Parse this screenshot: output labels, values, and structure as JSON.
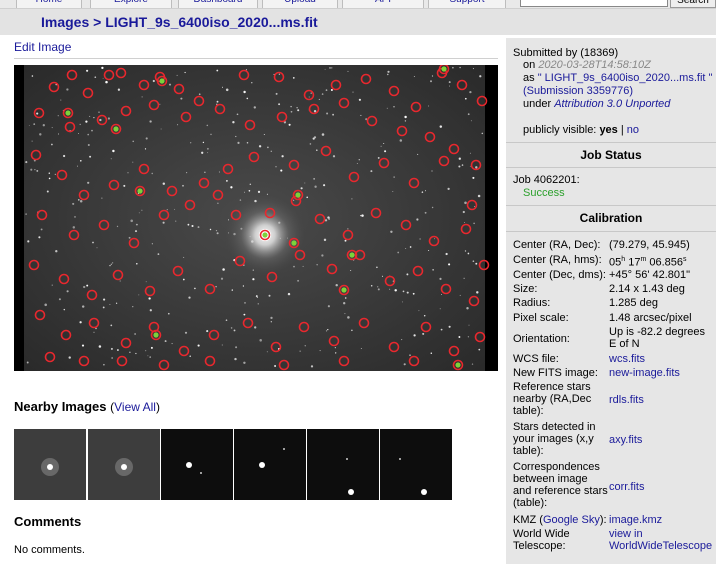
{
  "nav": {
    "items": [
      "Home",
      "Explore",
      "Dashboard",
      "Upload",
      "API",
      "Support"
    ],
    "search_button": "Search"
  },
  "breadcrumb": {
    "section": "Images",
    "separator": ">",
    "current": "LIGHT_9s_6400iso_2020...ms.fit"
  },
  "edit_image": "Edit Image",
  "nearby": {
    "heading": "Nearby Images",
    "view_all": "View All",
    "thumb_count": 6
  },
  "comments": {
    "heading": "Comments",
    "empty_text": "No comments."
  },
  "submission": {
    "submitted_by_label": "Submitted by",
    "submitter": "(18369)",
    "on_label": "on",
    "date": "2020-03-28T14:58:10Z",
    "as_label": "as",
    "file": "\" LIGHT_9s_6400iso_2020...ms.fit \"",
    "submission_link": "(Submission 3359776)",
    "under_label": "under",
    "license": "Attribution 3.0 Unported",
    "public_label": "publicly visible:",
    "public_yes": "yes",
    "public_sep": "|",
    "public_no": "no"
  },
  "job": {
    "heading": "Job Status",
    "job_label": "Job 4062201:",
    "status": "Success"
  },
  "calibration": {
    "heading": "Calibration",
    "rows": [
      {
        "key": "Center (RA, Dec):",
        "value": "(79.279, 45.945)"
      },
      {
        "key": "Center (RA, hms):",
        "value": "05h 17m 06.856s"
      },
      {
        "key": "Center (Dec, dms):",
        "value": "+45° 56' 42.801\""
      },
      {
        "key": "Size:",
        "value": "2.14 x 1.43 deg"
      },
      {
        "key": "Radius:",
        "value": "1.285 deg"
      },
      {
        "key": "Pixel scale:",
        "value": "1.48 arcsec/pixel"
      },
      {
        "key": "Orientation:",
        "value": "Up is -82.2 degrees E of N"
      },
      {
        "key": "WCS file:",
        "value": "wcs.fits"
      },
      {
        "key": "New FITS image:",
        "value": "new-image.fits"
      },
      {
        "key": "Reference stars nearby (RA,Dec table):",
        "value": "rdls.fits"
      },
      {
        "key": "Stars detected in your images (x,y table):",
        "value": "axy.fits"
      },
      {
        "key": "Correspondences between image and reference stars (table):",
        "value": "corr.fits"
      },
      {
        "key": "KMZ (Google Sky):",
        "value": "image.kmz"
      },
      {
        "key": "World Wide Telescope:",
        "value": "view in WorldWideTelescope"
      }
    ]
  },
  "colors": {
    "link": "#1a1a9a",
    "success": "#2ca02c",
    "marker_red": "#e8282e",
    "marker_green": "#7cd23a",
    "sidebar_bg": "#e6e6e6"
  }
}
